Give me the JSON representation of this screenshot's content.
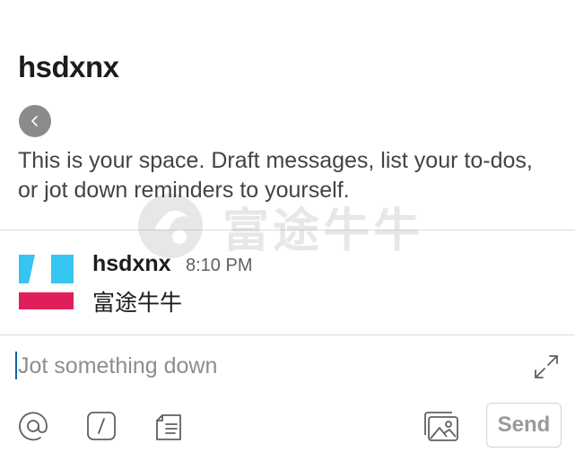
{
  "header": {
    "title": "hsdxnx",
    "back_icon": "chevron-left-icon"
  },
  "intro": {
    "text": "This is your space. Draft messages, list your to-dos, or jot down reminders to yourself."
  },
  "watermark": {
    "text": "富途牛牛"
  },
  "messages": [
    {
      "author": "hsdxnx",
      "time": "8:10 PM",
      "body": "富途牛牛",
      "avatar_colors": [
        "#36c5f0",
        "#e01e5a"
      ]
    }
  ],
  "composer": {
    "placeholder": "Jot something down",
    "value": "",
    "expand_icon": "expand-icon",
    "toolbar": [
      {
        "name": "mention-icon"
      },
      {
        "name": "slash-command-icon"
      },
      {
        "name": "formatting-icon"
      },
      {
        "name": "image-attach-icon"
      }
    ],
    "send_label": "Send"
  }
}
